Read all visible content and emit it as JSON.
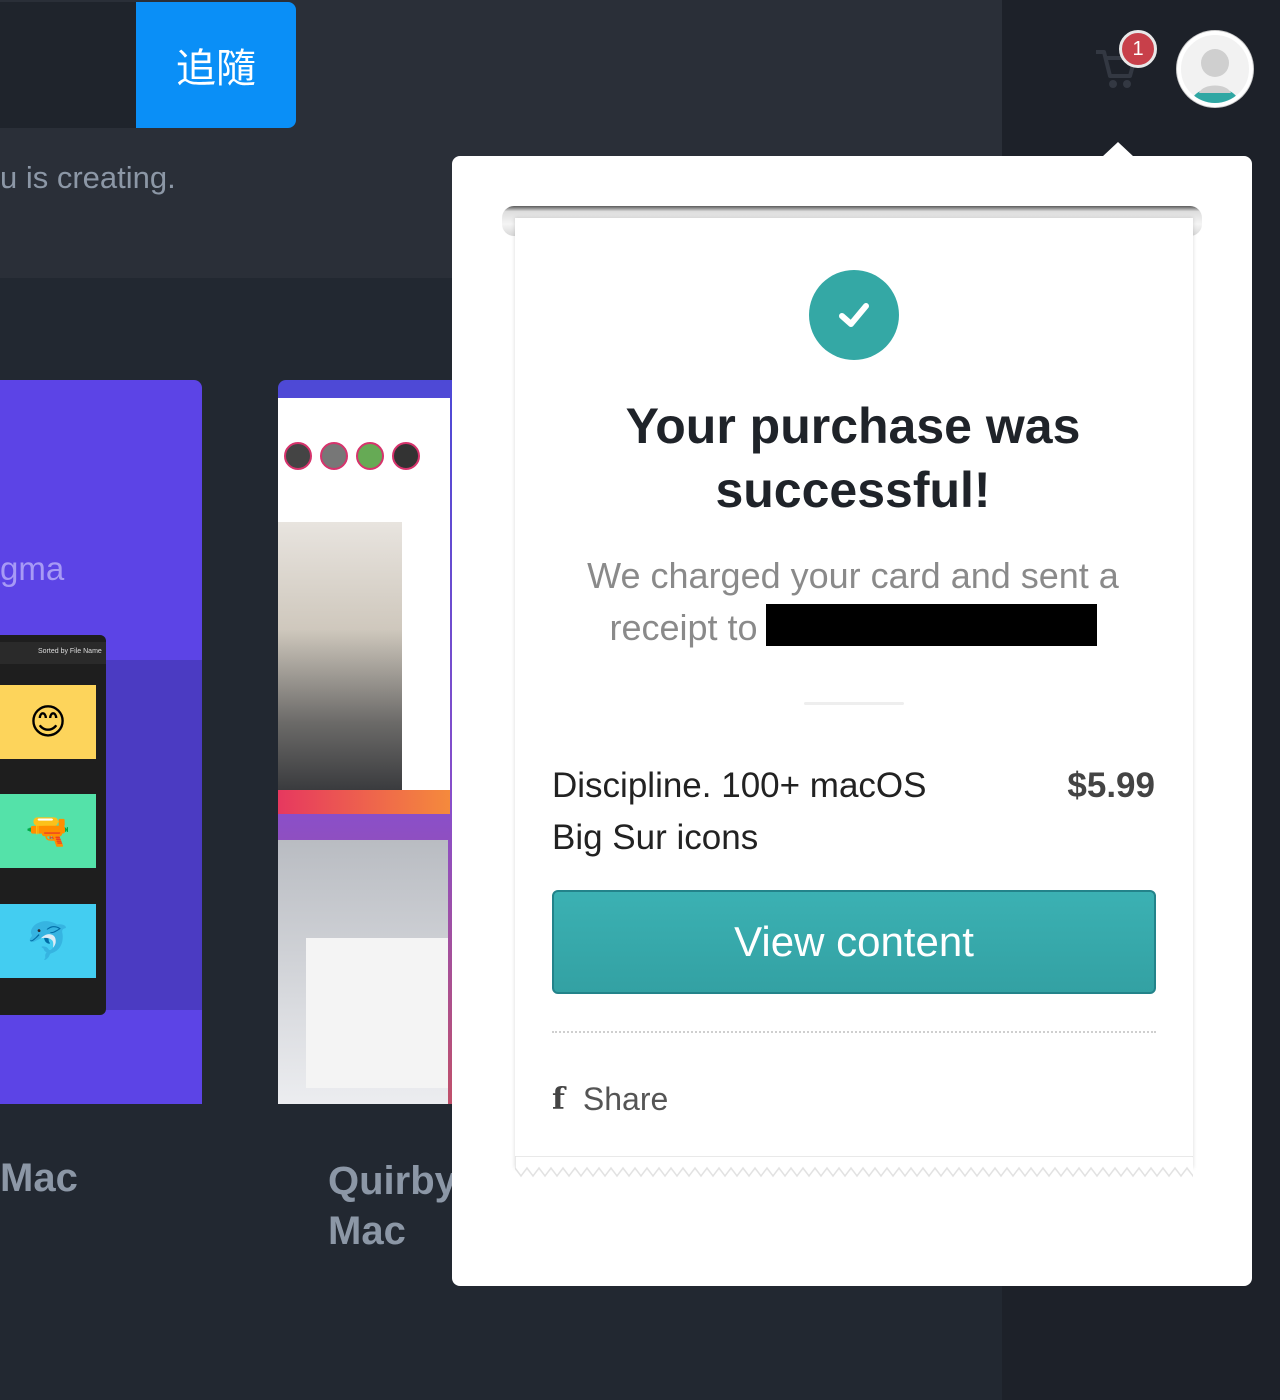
{
  "header": {
    "follow_label": "追隨",
    "tagline": "u is creating.",
    "cart_badge": "1"
  },
  "background_cards": {
    "card1": {
      "title": "gma",
      "emoji_a": "😊",
      "emoji_b": "🔫",
      "emoji_c": "🐬",
      "toolbar": "Sorted by File Name",
      "caption": "Mac"
    },
    "card2": {
      "caption": "Quirby\nMac"
    }
  },
  "popover": {
    "headline": "Your purchase was successful!",
    "subtext": "We charged your card and sent a receipt to",
    "item_name": "Discipline. 100+ macOS Big Sur icons",
    "item_price": "$5.99",
    "view_button": "View content",
    "share_label": "Share",
    "accent_color": "#34a8a5"
  }
}
